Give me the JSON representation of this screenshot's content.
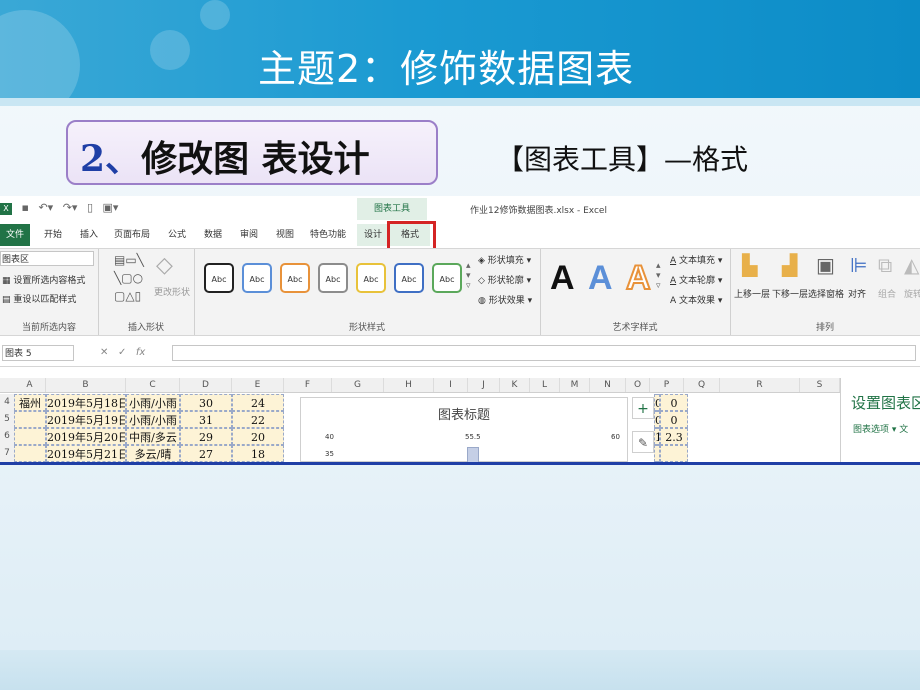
{
  "slide": {
    "title": "主题2：修饰数据图表",
    "subtitle_num": "2、",
    "subtitle_text": "修改图 表设计",
    "tool_path": "【图表工具】—格式"
  },
  "excel": {
    "file_name": "作业12修饰数据图表.xlsx - Excel",
    "context_tab": "图表工具",
    "tabs": [
      "文件",
      "开始",
      "插入",
      "页面布局",
      "公式",
      "数据",
      "审阅",
      "视图",
      "特色功能",
      "设计",
      "格式"
    ],
    "active_tab": "格式",
    "ribbon": {
      "current_selection": {
        "dropdown_value": "图表区",
        "format_selection": "设置所选内容格式",
        "reset_style": "重设以匹配样式",
        "label": "当前所选内容"
      },
      "insert_shapes": {
        "change_shape": "更改形状",
        "label": "插入形状"
      },
      "shape_styles": {
        "preset_label": "Abc",
        "fill": "形状填充",
        "outline": "形状轮廓",
        "effects": "形状效果",
        "label": "形状样式",
        "preset_colors": [
          "#222222",
          "#5b8fd8",
          "#e8923a",
          "#8c8c8c",
          "#e8c23a",
          "#3f6fc4",
          "#5ba85b"
        ]
      },
      "wordart": {
        "letter": "A",
        "text_fill": "文本填充",
        "text_outline": "文本轮廓",
        "text_effects": "文本效果",
        "label": "艺术字样式"
      },
      "arrange": {
        "bring_forward": "上移一层",
        "send_backward": "下移一层",
        "selection_pane": "选择窗格",
        "align": "对齐",
        "group": "组合",
        "rotate": "旋转",
        "label": "排列"
      }
    },
    "name_box": "图表 5",
    "fx_label": "fx",
    "columns": [
      "A",
      "B",
      "C",
      "D",
      "E",
      "F",
      "G",
      "H",
      "I",
      "J",
      "K",
      "L",
      "M",
      "N",
      "O",
      "P",
      "Q",
      "R",
      "S"
    ],
    "rows": [
      {
        "num": "4",
        "a": "福州",
        "b": "2019年5月18日",
        "c": "小雨/小雨",
        "d": "30",
        "e": "24",
        "o": "0",
        "p": "0"
      },
      {
        "num": "5",
        "a": "",
        "b": "2019年5月19日",
        "c": "小雨/小雨",
        "d": "31",
        "e": "22",
        "o": "0",
        "p": "0"
      },
      {
        "num": "6",
        "a": "",
        "b": "2019年5月20日",
        "c": "中雨/多云",
        "d": "29",
        "e": "20",
        "o": "1",
        "p": "2.3"
      },
      {
        "num": "7",
        "a": "",
        "b": "2019年5月21日",
        "c": "多云/晴",
        "d": "27",
        "e": "18",
        "o": "",
        "p": ""
      }
    ],
    "chart": {
      "title": "图表标题",
      "y_ticks": [
        "40",
        "35"
      ],
      "data_label": "55.5",
      "right_tick": "60"
    },
    "task_pane": {
      "title": "设置图表区",
      "options": "图表选项"
    }
  }
}
